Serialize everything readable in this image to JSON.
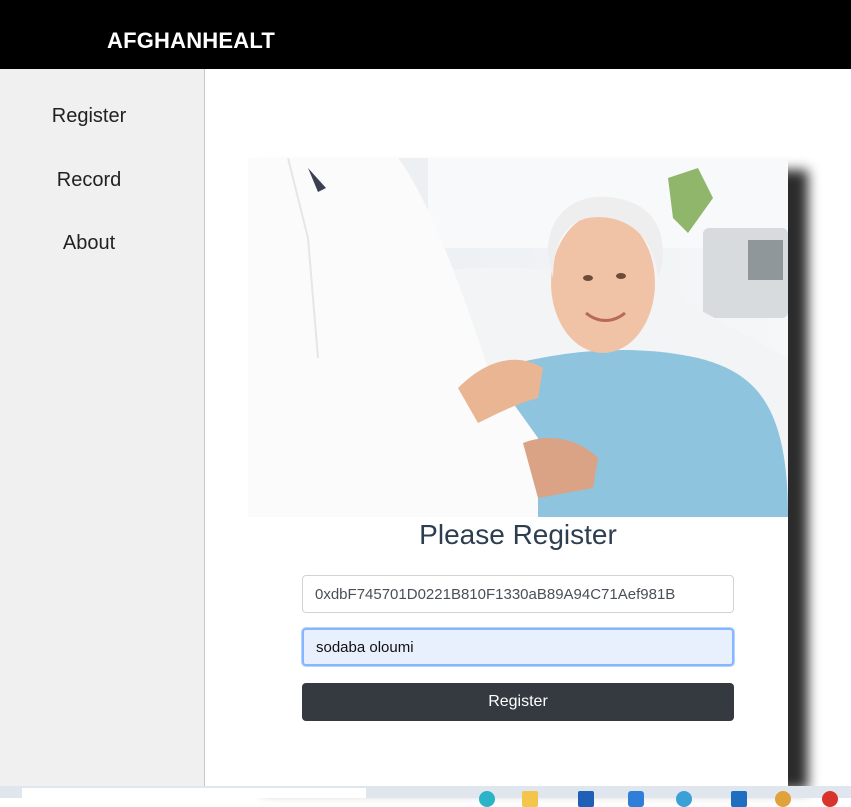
{
  "header": {
    "brand": "AFGHANHEALT"
  },
  "sidebar": {
    "items": [
      {
        "label": "Register"
      },
      {
        "label": "Record"
      },
      {
        "label": "About"
      }
    ]
  },
  "main": {
    "title": "Please Register",
    "address_field": {
      "value": "0xdbF745701D0221B810F1330aB89A94C71Aef981B"
    },
    "name_field": {
      "value": "sodaba oloumi"
    },
    "register_button": {
      "label": "Register"
    }
  },
  "colors": {
    "header_bg": "#000000",
    "sidebar_bg": "#f0f0f0",
    "button_bg": "#343a40",
    "title_color": "#2d3e50"
  }
}
